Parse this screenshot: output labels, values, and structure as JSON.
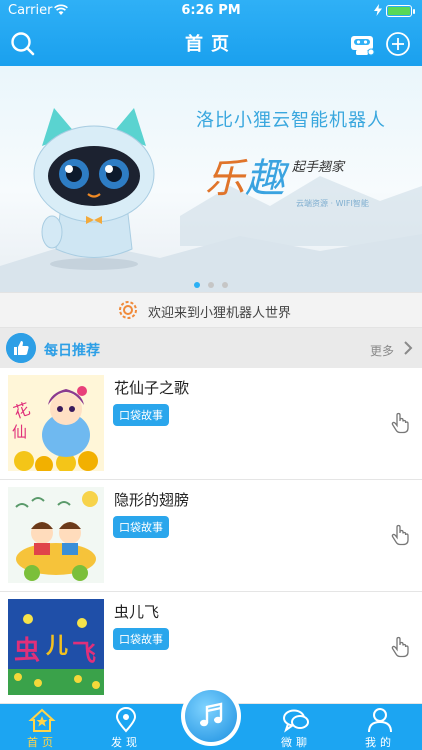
{
  "status_bar": {
    "carrier": "Carrier",
    "time": "6:26 PM",
    "battery_level": 1.0
  },
  "nav": {
    "title": "首页"
  },
  "banner": {
    "title": "洛比小狸云智能机器人",
    "slogan_a": "乐",
    "slogan_b": "趣",
    "subtitle": "起手翘家",
    "tagline": "云端资源 · WIFI智能",
    "page_count": 3,
    "active_page": 0
  },
  "welcome": {
    "text": "欢迎来到小狸机器人世界"
  },
  "section": {
    "title": "每日推荐",
    "more": "更多"
  },
  "items": [
    {
      "title": "花仙子之歌",
      "tag": "口袋故事",
      "cover": "flower-fairy"
    },
    {
      "title": "隐形的翅膀",
      "tag": "口袋故事",
      "cover": "kids-car"
    },
    {
      "title": "虫儿飞",
      "tag": "口袋故事",
      "cover": "fireflies"
    }
  ],
  "tabs": [
    {
      "label": "首页",
      "icon": "home-icon",
      "active": true
    },
    {
      "label": "发现",
      "icon": "location-icon",
      "active": false
    },
    {
      "label": "微聊",
      "icon": "chat-icon",
      "active": false
    },
    {
      "label": "我的",
      "icon": "user-icon",
      "active": false
    }
  ],
  "colors": {
    "primary": "#1ca5f2",
    "active_tab": "#ffd54a",
    "tag": "#2aa6ec"
  }
}
